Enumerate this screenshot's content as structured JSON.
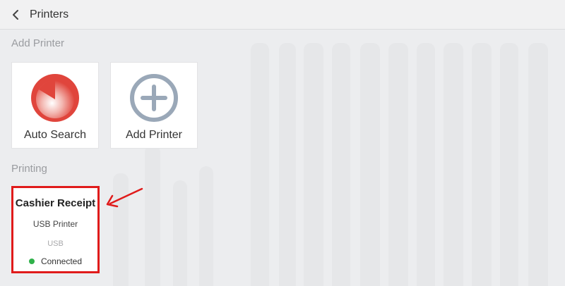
{
  "header": {
    "title": "Printers",
    "back_icon": "chevron-left-icon"
  },
  "add_printer_section": {
    "label": "Add Printer",
    "tiles": [
      {
        "label": "Auto Search",
        "icon": "auto-search-icon",
        "color": "#e0453c"
      },
      {
        "label": "Add Printer",
        "icon": "plus-circle-icon",
        "color": "#9aa8b8"
      }
    ]
  },
  "printing_section": {
    "label": "Printing",
    "printer": {
      "name": "Cashier Receipt",
      "type": "USB Printer",
      "connection": "USB",
      "status": "Connected",
      "status_color": "#2fb14a"
    }
  },
  "annotation": {
    "highlight_color": "#e01b1b",
    "arrow_icon": "arrow-left-icon"
  }
}
